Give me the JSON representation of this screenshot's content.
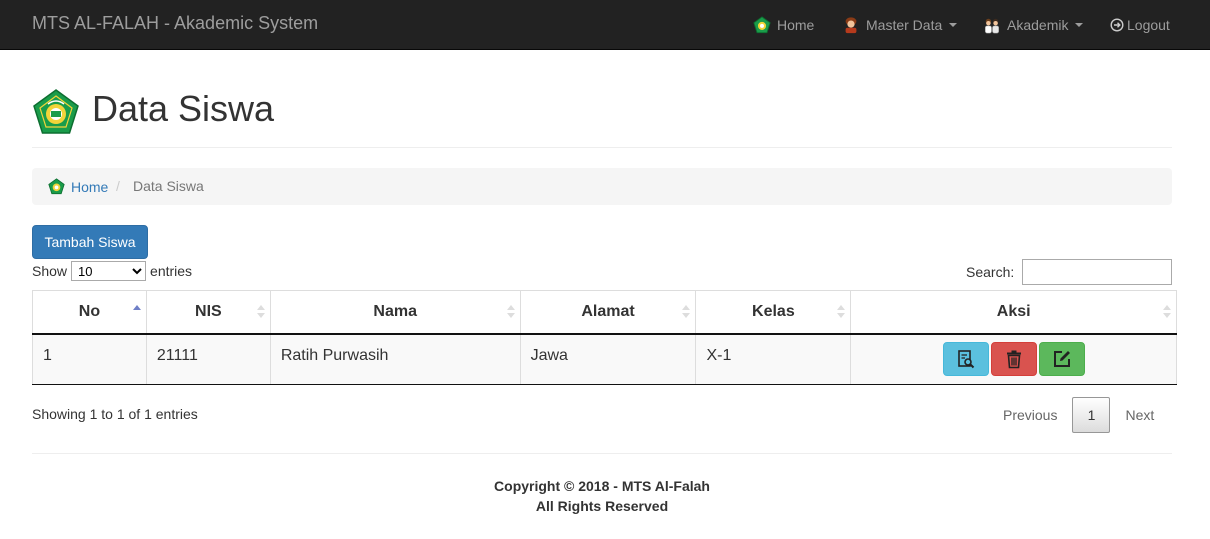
{
  "navbar": {
    "brand": "MTS AL-FALAH - Akademic System",
    "items": [
      {
        "label": "Home",
        "icon": "emblem-icon"
      },
      {
        "label": "Master Data",
        "icon": "student-icon",
        "dropdown": true
      },
      {
        "label": "Akademik",
        "icon": "people-icon",
        "dropdown": true
      },
      {
        "label": "Logout",
        "icon": "logout-icon"
      }
    ]
  },
  "page": {
    "title": "Data Siswa"
  },
  "breadcrumb": {
    "home": "Home",
    "current": "Data Siswa"
  },
  "actions": {
    "add_label": "Tambah Siswa"
  },
  "table_controls": {
    "show_label": "Show",
    "length_value": "10",
    "entries_label": "entries",
    "search_label": "Search:",
    "search_value": ""
  },
  "table": {
    "columns": [
      "No",
      "NIS",
      "Nama",
      "Alamat",
      "Kelas",
      "Aksi"
    ],
    "sorted_column": "No",
    "sort_direction": "asc",
    "rows": [
      {
        "no": "1",
        "nis": "21111",
        "nama": "Ratih Purwasih",
        "alamat": "Jawa",
        "kelas": "X-1"
      }
    ]
  },
  "info": "Showing 1 to 1 of 1 entries",
  "pagination": {
    "previous": "Previous",
    "current": "1",
    "next": "Next"
  },
  "footer": {
    "line1": "Copyright © 2018 - MTS Al-Falah",
    "line2": "All Rights Reserved"
  },
  "colors": {
    "navbar_bg": "#222222",
    "primary": "#337ab7",
    "info": "#5bc0de",
    "danger": "#d9534f",
    "success": "#5cb85c",
    "emblem_green": "#1a9c4a"
  }
}
